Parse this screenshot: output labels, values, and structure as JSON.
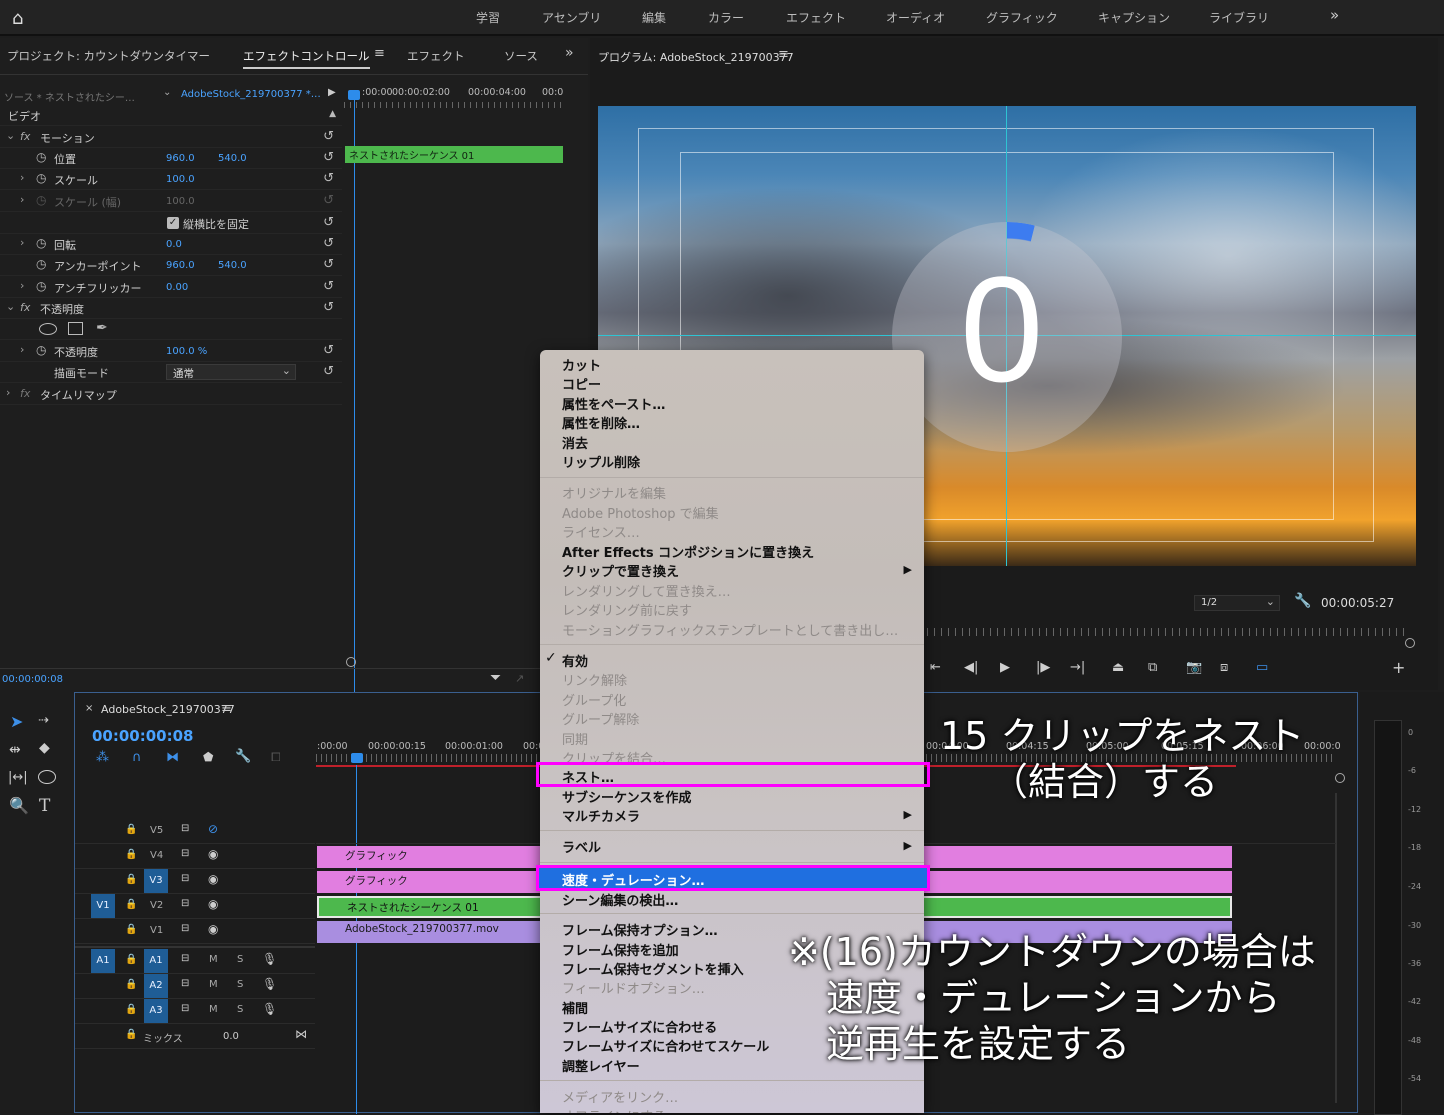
{
  "workspace_tabs": [
    "学習",
    "アセンブリ",
    "編集",
    "カラー",
    "エフェクト",
    "オーディオ",
    "グラフィック",
    "キャプション",
    "ライブラリ"
  ],
  "left_tabs": {
    "project": "プロジェクト: カウントダウンタイマー",
    "effect_controls": "エフェクトコントロール",
    "effects": "エフェクト",
    "source": "ソース"
  },
  "ec": {
    "source_label": "ソース * ネストされたシー…",
    "clip_label": "AdobeStock_219700377 *…",
    "times": [
      ":00:00",
      "00:00:02:00",
      "00:00:04:00",
      "00:0"
    ],
    "mini_clip": "ネストされたシーケンス 01",
    "video": "ビデオ",
    "motion": "モーション",
    "position": "位置",
    "pos_x": "960.0",
    "pos_y": "540.0",
    "scale": "スケール",
    "scale_v": "100.0",
    "scale_w": "スケール (幅)",
    "scale_w_v": "100.0",
    "uniform": "縦横比を固定",
    "rotation": "回転",
    "rotation_v": "0.0",
    "anchor": "アンカーポイント",
    "anchor_x": "960.0",
    "anchor_y": "540.0",
    "flicker": "アンチフリッカー",
    "flicker_v": "0.00",
    "opacity_fx": "不透明度",
    "opacity": "不透明度",
    "opacity_v": "100.0 %",
    "blend": "描画モード",
    "blend_v": "通常",
    "remap": "タイムリマップ",
    "timecode": "00:00:00:08"
  },
  "program": {
    "title": "プログラム: AdobeStock_219700377",
    "digit": "0",
    "zoom": "1/2",
    "duration": "00:00:05:27"
  },
  "timeline": {
    "seq_name": "AdobeStock_219700377",
    "timecode": "00:00:00:08",
    "ruler": [
      ":00:00",
      "00:00:00:15",
      "00:00:01:00",
      "00:0",
      "00:04:00",
      "00:04:15",
      "00:05:00",
      "00:05:15",
      "00:06:00",
      "00:00:0"
    ],
    "tracks_v": [
      "V5",
      "V4",
      "V3",
      "V2",
      "V1"
    ],
    "tracks_a": [
      "A1",
      "A2",
      "A3"
    ],
    "mix": "ミックス",
    "mix_v": "0.0",
    "clips": {
      "v4": "グラフィック",
      "v3": "グラフィック",
      "v2": "ネストされたシーケンス 01",
      "v1": "AdobeStock_219700377.mov"
    },
    "m": "M",
    "s": "S",
    "src_v": "V1",
    "src_a": "A1"
  },
  "meter_labels": [
    "0",
    "-6",
    "-12",
    "-18",
    "-24",
    "-30",
    "-36",
    "-42",
    "-48",
    "-54"
  ],
  "menu": {
    "items": [
      {
        "label": "カット",
        "enabled": true
      },
      {
        "label": "コピー",
        "enabled": true
      },
      {
        "label": "属性をペースト…",
        "enabled": true
      },
      {
        "label": "属性を削除…",
        "enabled": true
      },
      {
        "label": "消去",
        "enabled": true
      },
      {
        "label": "リップル削除",
        "enabled": true
      },
      {
        "label": "オリジナルを編集",
        "enabled": false
      },
      {
        "label": "Adobe Photoshop で編集",
        "enabled": false
      },
      {
        "label": "ライセンス…",
        "enabled": false
      },
      {
        "label": "After Effects コンポジションに置き換え",
        "enabled": true
      },
      {
        "label": "クリップで置き換え",
        "enabled": true
      },
      {
        "label": "レンダリングして置き換え…",
        "enabled": false
      },
      {
        "label": "レンダリング前に戻す",
        "enabled": false
      },
      {
        "label": "モーショングラフィックステンプレートとして書き出し…",
        "enabled": false
      },
      {
        "label": "有効",
        "enabled": true
      },
      {
        "label": "リンク解除",
        "enabled": false
      },
      {
        "label": "グループ化",
        "enabled": false
      },
      {
        "label": "グループ解除",
        "enabled": false
      },
      {
        "label": "同期",
        "enabled": false
      },
      {
        "label": "クリップを結合…",
        "enabled": false
      },
      {
        "label": "ネスト…",
        "enabled": true
      },
      {
        "label": "サブシーケンスを作成",
        "enabled": true
      },
      {
        "label": "マルチカメラ",
        "enabled": true
      },
      {
        "label": "ラベル",
        "enabled": true
      },
      {
        "label": "速度・デュレーション…",
        "enabled": true
      },
      {
        "label": "シーン編集の検出…",
        "enabled": true
      },
      {
        "label": "フレーム保持オプション…",
        "enabled": true
      },
      {
        "label": "フレーム保持を追加",
        "enabled": true
      },
      {
        "label": "フレーム保持セグメントを挿入",
        "enabled": true
      },
      {
        "label": "フィールドオプション…",
        "enabled": false
      },
      {
        "label": "補間",
        "enabled": true
      },
      {
        "label": "フレームサイズに合わせる",
        "enabled": true
      },
      {
        "label": "フレームサイズに合わせてスケール",
        "enabled": true
      },
      {
        "label": "調整レイヤー",
        "enabled": true
      },
      {
        "label": "メディアをリンク…",
        "enabled": false
      },
      {
        "label": "オフラインにする…",
        "enabled": false
      }
    ],
    "check": "✓"
  },
  "annotations": {
    "step15_line1": "15 クリップをネスト",
    "step15_line2": "（結合）する",
    "note_line1": "※(16)カウントダウンの場合は",
    "note_line2": "速度・デュレーションから",
    "note_line3": "逆再生を設定する"
  },
  "colors": {
    "accent": "#2d8ceb",
    "highlight": "#ff00ff",
    "clip_pink": "#e17ee0",
    "clip_green": "#4db84d",
    "clip_purple": "#a98ee0"
  }
}
